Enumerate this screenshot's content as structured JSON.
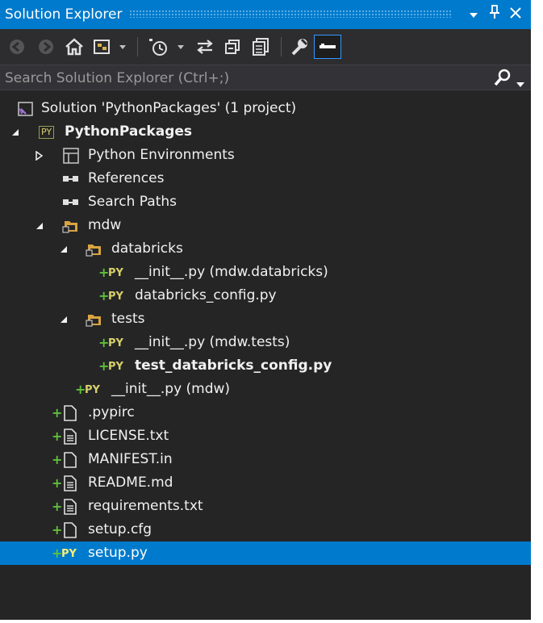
{
  "titlebar": {
    "title": "Solution Explorer",
    "buttons": [
      "pin-dropdown-icon",
      "pushpin-icon",
      "close-icon"
    ]
  },
  "toolbar": {
    "tools": [
      "back-icon",
      "forward-icon",
      "home-icon",
      "switch-views-icon",
      "pending-changes-filter-icon",
      "sync-icon",
      "collapse-all-icon",
      "show-all-files-icon",
      "properties-icon",
      "preview-icon"
    ]
  },
  "search": {
    "placeholder": "Search Solution Explorer (Ctrl+;)"
  },
  "colors": {
    "accent": "#007acc",
    "panel_bg": "#252526",
    "added_plus": "#5fbf3a",
    "python_icon": "#d7d06a"
  },
  "tree": {
    "solution": "Solution 'PythonPackages' (1 project)",
    "project": "PythonPackages",
    "python_environments": "Python Environments",
    "references": "References",
    "search_paths": "Search Paths",
    "mdw": "mdw",
    "databricks": "databricks",
    "databricks_init": "__init__.py (mdw.databricks)",
    "databricks_config": "databricks_config.py",
    "tests": "tests",
    "tests_init": "__init__.py (mdw.tests)",
    "test_config": "test_databricks_config.py",
    "mdw_init": "__init__.py (mdw)",
    "pypirc": ".pypirc",
    "license": "LICENSE.txt",
    "manifest": "MANIFEST.in",
    "readme": "README.md",
    "requirements": "requirements.txt",
    "setup_cfg": "setup.cfg",
    "setup_py": "setup.py",
    "py_badge": "PY",
    "plus": "+"
  }
}
